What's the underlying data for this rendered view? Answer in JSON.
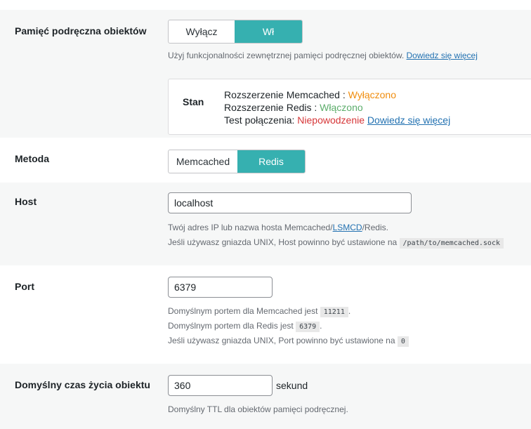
{
  "object_cache": {
    "label": "Pamięć podręczna obiektów",
    "toggle": {
      "off_label": "Wyłącz",
      "on_label": "Wł",
      "selected": "on"
    },
    "description": "Użyj funkcjonalności zewnętrznej pamięci podręcznej obiektów.",
    "learn_more": "Dowiedz się więcej",
    "status": {
      "title": "Stan",
      "memcached_label": "Rozszerzenie Memcached : ",
      "memcached_value": "Wyłączono",
      "redis_label": "Rozszerzenie Redis : ",
      "redis_value": "Włączono",
      "connection_label": "Test połączenia: ",
      "connection_value": "Niepowodzenie",
      "learn_more": "Dowiedz się więcej"
    }
  },
  "method": {
    "label": "Metoda",
    "options": [
      "Memcached",
      "Redis"
    ],
    "selected": "Redis"
  },
  "host": {
    "label": "Host",
    "value": "localhost",
    "desc_line1_a": "Twój adres IP lub nazwa hosta Memcached/",
    "desc_link": "LSMCD",
    "desc_line1_b": "/Redis.",
    "desc_line2": "Jeśli używasz gniazda UNIX, Host powinno być ustawione na",
    "socket_path": "/path/to/memcached.sock"
  },
  "port": {
    "label": "Port",
    "value": "6379",
    "desc_memcached": "Domyślnym portem dla Memcached jest",
    "memcached_port": "11211",
    "desc_redis": "Domyślnym portem dla Redis jest",
    "redis_port": "6379",
    "desc_unix": "Jeśli używasz gniazda UNIX, Port powinno być ustawione na",
    "unix_port": "0"
  },
  "ttl": {
    "label": "Domyślny czas życia obiektu",
    "value": "360",
    "unit": "sekund",
    "description": "Domyślny TTL dla obiektów pamięci podręcznej."
  },
  "colors": {
    "accent": "#36b0b0",
    "link": "#2271b1",
    "warning": "#f08d0e",
    "success": "#5cad6b",
    "error": "#d63638"
  }
}
